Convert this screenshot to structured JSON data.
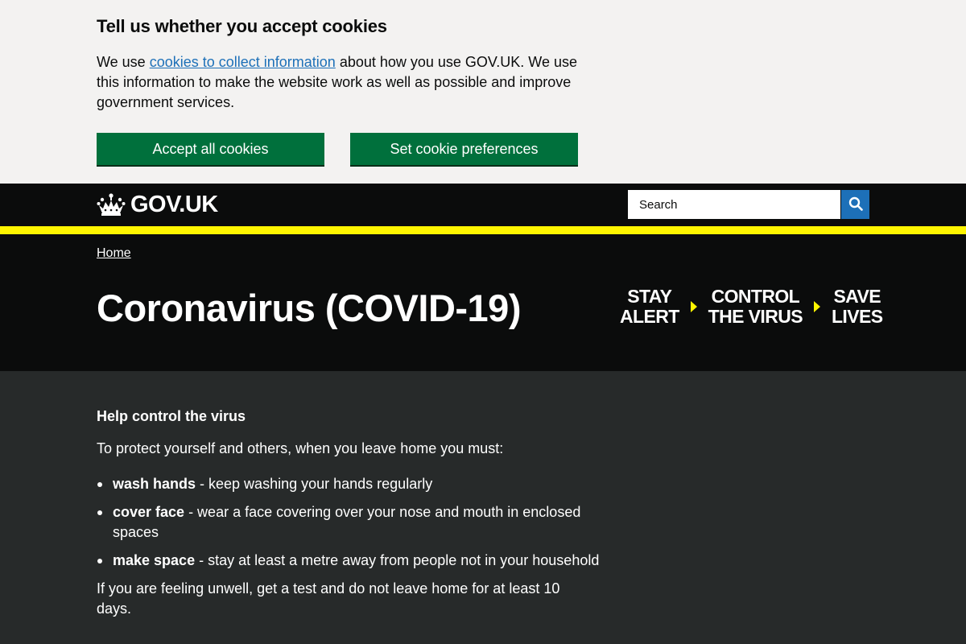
{
  "cookie_banner": {
    "title": "Tell us whether you accept cookies",
    "text_before_link": "We use ",
    "link_text": "cookies to collect information",
    "text_after_link": " about how you use GOV.UK. We use this information to make the website work as well as possible and improve government services.",
    "accept_label": "Accept all cookies",
    "preferences_label": "Set cookie preferences"
  },
  "header": {
    "logo_text": "GOV.UK",
    "search_placeholder": "Search"
  },
  "colors": {
    "header_bg": "#0b0c0c",
    "accent_yellow": "#fff500",
    "button_green": "#00703c",
    "link_blue": "#1d70b8",
    "content_bg": "#272a2a",
    "banner_bg": "#f3f2f1"
  },
  "hero": {
    "breadcrumb": "Home",
    "title": "Coronavirus (COVID-19)",
    "slogan": [
      {
        "line1": "STAY",
        "line2": "ALERT"
      },
      {
        "line1": "CONTROL",
        "line2": "THE VIRUS"
      },
      {
        "line1": "SAVE",
        "line2": "LIVES"
      }
    ]
  },
  "content": {
    "heading": "Help control the virus",
    "intro": "To protect yourself and others, when you leave home you must:",
    "rules": [
      {
        "bold": "wash hands",
        "text": " - keep washing your hands regularly"
      },
      {
        "bold": "cover face",
        "text": " - wear a face covering over your nose and mouth in enclosed spaces"
      },
      {
        "bold": "make space",
        "text": " - stay at least a metre away from people not in your household"
      }
    ],
    "unwell": "If you are feeling unwell, get a test and do not leave home for at least 10 days."
  },
  "icons": {
    "logo": "crown-icon",
    "search": "search-icon",
    "slogan_separator": "chevron-right-icon"
  }
}
